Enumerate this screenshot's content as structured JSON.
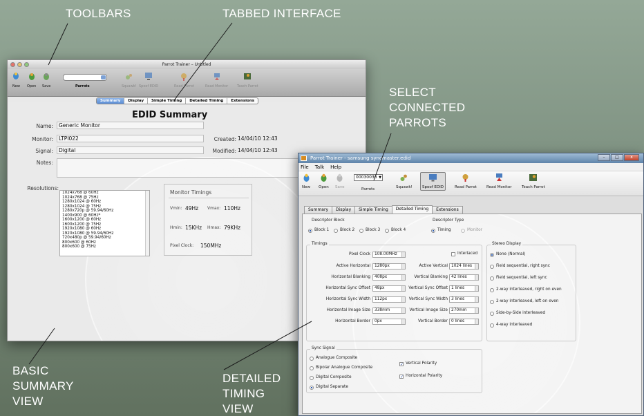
{
  "annotations": {
    "toolbars": "TOOLBARS",
    "tabbed_interface": "TABBED INTERFACE",
    "select_connected_parrots": [
      "SELECT",
      "CONNECTED",
      "PARROTS"
    ],
    "basic_summary_view": [
      "BASIC",
      "SUMMARY",
      "VIEW"
    ],
    "detailed_timing_view": [
      "DETAILED",
      "TIMING",
      "VIEW"
    ]
  },
  "mac_window": {
    "title": "Parrot Trainer – Untitled",
    "toolbar": {
      "new": "New",
      "open": "Open",
      "save": "Save",
      "parrots_label": "Parrots",
      "squawk": "Squawk!",
      "spoof_edid": "Spoof EDID",
      "read_parrot": "Read Parrot",
      "read_monitor": "Read Monitor",
      "teach_parrot": "Teach Parrot"
    },
    "tabs": [
      "Summary",
      "Display",
      "Simple Timing",
      "Detailed Timing",
      "Extensions"
    ],
    "active_tab": "Summary",
    "heading": "EDID Summary",
    "fields": {
      "name_label": "Name:",
      "name_value": "Generic Monitor",
      "monitor_label": "Monitor:",
      "monitor_value": "LTPI022",
      "signal_label": "Signal:",
      "signal_value": "Digital",
      "notes_label": "Notes:",
      "created_label": "Created:",
      "created_value": "14/04/10 12:43",
      "modified_label": "Modified:",
      "modified_value": "14/04/10 12:43",
      "resolutions_label": "Resolutions:"
    },
    "resolutions": [
      "1024x768 @ 60Hz",
      "1024x768 @ 75Hz",
      "1280x1024 @ 60Hz",
      "1280x1024 @ 75Hz",
      "1280x720p @ 59.94/60Hz",
      "1400x900 @ 60Hz*",
      "1600x1200 @ 60Hz",
      "1600x1200 @ 75Hz",
      "1920x1080 @ 60Hz",
      "1920x1080 @ 59.94/60Hz",
      "720x480p @ 59.94/60Hz",
      "800x600 @ 60Hz",
      "800x600 @ 75Hz"
    ],
    "monitor_timings": {
      "title": "Monitor Timings",
      "vmin_label": "Vmin:",
      "vmin_value": "49Hz",
      "vmax_label": "Vmax:",
      "vmax_value": "110Hz",
      "hmin_label": "Hmin:",
      "hmin_value": "15KHz",
      "hmax_label": "Hmax:",
      "hmax_value": "79KHz",
      "pixel_clock_label": "Pixel Clock:",
      "pixel_clock_value": "150MHz"
    }
  },
  "win_window": {
    "title": "Parrot Trainer - samsung syncmaster.edid",
    "controls": {
      "minimize": "–",
      "maximize": "□",
      "close": "x"
    },
    "menu": [
      "File",
      "Talk",
      "Help"
    ],
    "toolbar": {
      "new": "New",
      "open": "Open",
      "save": "Save",
      "parrot_select_value": "00030036",
      "parrots_label": "Parrots",
      "squawk": "Squawk!",
      "spoof_edid": "Spoof EDID",
      "read_parrot": "Read Parrot",
      "read_monitor": "Read Monitor",
      "teach_parrot": "Teach Parrot"
    },
    "tabs": [
      "Summary",
      "Display",
      "Simple Timing",
      "Detailed Timing",
      "Extensions"
    ],
    "active_tab": "Detailed Timing",
    "descriptor_block": {
      "label": "Descriptor Block",
      "options": [
        "Block 1",
        "Block 2",
        "Block 3",
        "Block 4"
      ],
      "selected": "Block 1"
    },
    "descriptor_type": {
      "label": "Descriptor Type",
      "options": [
        "Timing",
        "Monitor"
      ],
      "selected": "Timing"
    },
    "timings": {
      "label": "Timings",
      "pixel_clock_label": "Pixel Clock",
      "pixel_clock_value": "108.00MHz",
      "interlaced_label": "Interlaced",
      "interlaced_checked": false,
      "active_horizontal_label": "Active Horizontal",
      "active_horizontal_value": "1280px",
      "active_vertical_label": "Active Vertical",
      "active_vertical_value": "1024 lines",
      "horizontal_blanking_label": "Horizontal Blanking",
      "horizontal_blanking_value": "408px",
      "vertical_blanking_label": "Vertical Blanking",
      "vertical_blanking_value": "42 lines",
      "horizontal_sync_offset_label": "Horizontal Sync Offset",
      "horizontal_sync_offset_value": "48px",
      "vertical_sync_offset_label": "Vertical Sync Offset",
      "vertical_sync_offset_value": "1 lines",
      "horizontal_sync_width_label": "Horizontal Sync Width",
      "horizontal_sync_width_value": "112px",
      "vertical_sync_width_label": "Vertical Sync Width",
      "vertical_sync_width_value": "3 lines",
      "horizontal_image_size_label": "Horizontal Image Size",
      "horizontal_image_size_value": "338mm",
      "vertical_image_size_label": "Vertical Image Size",
      "vertical_image_size_value": "270mm",
      "horizontal_border_label": "Horizontal Border",
      "horizontal_border_value": "0px",
      "vertical_border_label": "Vertical Border",
      "vertical_border_value": "0 lines"
    },
    "stereo_display": {
      "label": "Stereo Display",
      "options": [
        "None (Normal)",
        "Field sequential, right sync",
        "Field sequential, left sync",
        "2-way interleaved, right on even",
        "2-way interleaved, left on even",
        "Side-by-Side interleaved",
        "4-way interleaved"
      ],
      "selected": "None (Normal)"
    },
    "sync_signal": {
      "label": "Sync Signal",
      "options": [
        "Analogue Composite",
        "Bipolar Analogue Composite",
        "Digital Composite",
        "Digital Separate"
      ],
      "selected": "Digital Separate",
      "vertical_polarity_label": "Vertical Polarity",
      "vertical_polarity_checked": true,
      "horizontal_polarity_label": "Horizontal Polarity",
      "horizontal_polarity_checked": true
    }
  }
}
